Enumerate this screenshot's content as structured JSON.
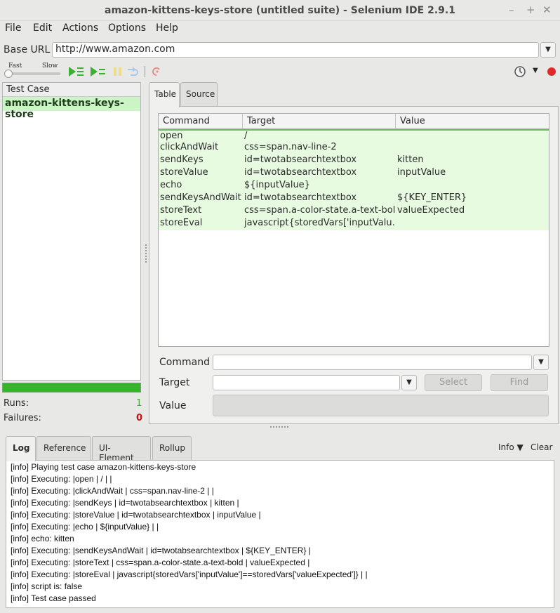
{
  "window": {
    "title": "amazon-kittens-keys-store (untitled suite) - Selenium IDE 2.9.1",
    "controls": [
      "–",
      "+",
      "✕"
    ]
  },
  "menu": [
    "File",
    "Edit",
    "Actions",
    "Options",
    "Help"
  ],
  "base_url": {
    "label": "Base URL",
    "value": "http://www.amazon.com"
  },
  "speed": {
    "fast": "Fast",
    "slow": "Slow"
  },
  "test_case_panel": {
    "header": "Test Case",
    "items": [
      "amazon-kittens-keys-store"
    ],
    "runs_label": "Runs:",
    "runs_value": "1",
    "failures_label": "Failures:",
    "failures_value": "0"
  },
  "editor": {
    "tabs": [
      "Table",
      "Source"
    ],
    "columns": [
      "Command",
      "Target",
      "Value"
    ],
    "rows": [
      [
        "open",
        "/",
        ""
      ],
      [
        "clickAndWait",
        "css=span.nav-line-2",
        ""
      ],
      [
        "sendKeys",
        "id=twotabsearchtextbox",
        "kitten"
      ],
      [
        "storeValue",
        "id=twotabsearchtextbox",
        "inputValue"
      ],
      [
        "echo",
        "${inputValue}",
        ""
      ],
      [
        "sendKeysAndWait",
        "id=twotabsearchtextbox",
        "${KEY_ENTER}"
      ],
      [
        "storeText",
        "css=span.a-color-state.a-text-bold",
        "valueExpected"
      ],
      [
        "storeEval",
        "javascript{storedVars['inputValu…",
        ""
      ]
    ],
    "command_label": "Command",
    "target_label": "Target",
    "value_label": "Value",
    "select_button": "Select",
    "find_button": "Find"
  },
  "log_panel": {
    "tabs": [
      "Log",
      "Reference",
      "UI-Element",
      "Rollup"
    ],
    "info_label": "Info",
    "clear_label": "Clear",
    "lines": [
      "[info] Playing test case amazon-kittens-keys-store",
      "[info] Executing: |open | / | |",
      "[info] Executing: |clickAndWait | css=span.nav-line-2 | |",
      "[info] Executing: |sendKeys | id=twotabsearchtextbox | kitten |",
      "[info] Executing: |storeValue | id=twotabsearchtextbox | inputValue |",
      "[info] Executing: |echo | ${inputValue} | |",
      "[info] echo: kitten",
      "[info] Executing: |sendKeysAndWait | id=twotabsearchtextbox | ${KEY_ENTER} |",
      "[info] Executing: |storeText | css=span.a-color-state.a-text-bold | valueExpected |",
      "[info] Executing: |storeEval | javascript{storedVars['inputValue']==storedVars['valueExpected']} | |",
      "[info] script is: false",
      "[info] Test case passed"
    ]
  },
  "colors": {
    "play_green": "#3fae36",
    "row_green": "#e7fbe1",
    "selected_case": "#ccf5c5",
    "progress": "#35b42c",
    "failure_red": "#c21515",
    "record_red": "#e02a2a"
  }
}
